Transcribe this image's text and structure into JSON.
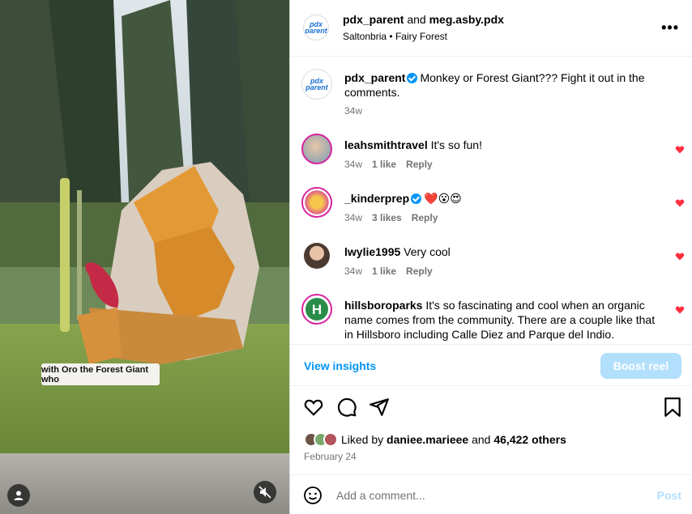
{
  "media": {
    "overlay_caption": "with Oro the Forest Giant who"
  },
  "header": {
    "user": "pdx_parent",
    "and_text": "and",
    "coauthor": "meg.asby.pdx",
    "location_1": "Saltonbria",
    "location_sep": "•",
    "location_2": "Fairy Forest",
    "more": "•••"
  },
  "caption": {
    "user": "pdx_parent",
    "text": "Monkey or Forest Giant??? Fight it out in the comments.",
    "time": "34w"
  },
  "comments": [
    {
      "user": "leahsmithtravel",
      "text": "It's so fun!",
      "time": "34w",
      "likes": "1 like",
      "reply": "Reply"
    },
    {
      "user": "_kinderprep",
      "text": "❤️😮😍",
      "time": "34w",
      "likes": "3 likes",
      "reply": "Reply"
    },
    {
      "user": "lwylie1995",
      "text": "Very cool",
      "time": "34w",
      "likes": "1 like",
      "reply": "Reply"
    },
    {
      "user": "hillsboroparks",
      "text": "It's so fascinating and cool when an organic name comes from the community. There are a couple like that in Hillsboro including Calle Diez and Parque del Indio.",
      "time": "",
      "likes": "",
      "reply": ""
    }
  ],
  "insights": {
    "view": "View insights",
    "boost": "Boost reel"
  },
  "likes": {
    "prefix": "Liked by",
    "user": "daniee.marieee",
    "and": "and",
    "others": "46,422 others"
  },
  "date": "February 24",
  "add_comment": {
    "placeholder": "Add a comment...",
    "post": "Post"
  },
  "logo": {
    "line1": "pdx",
    "line2": "parent"
  },
  "colors": {
    "accent": "#0095f6",
    "boost_disabled": "#b2dffc",
    "heart": "#ff3040"
  }
}
